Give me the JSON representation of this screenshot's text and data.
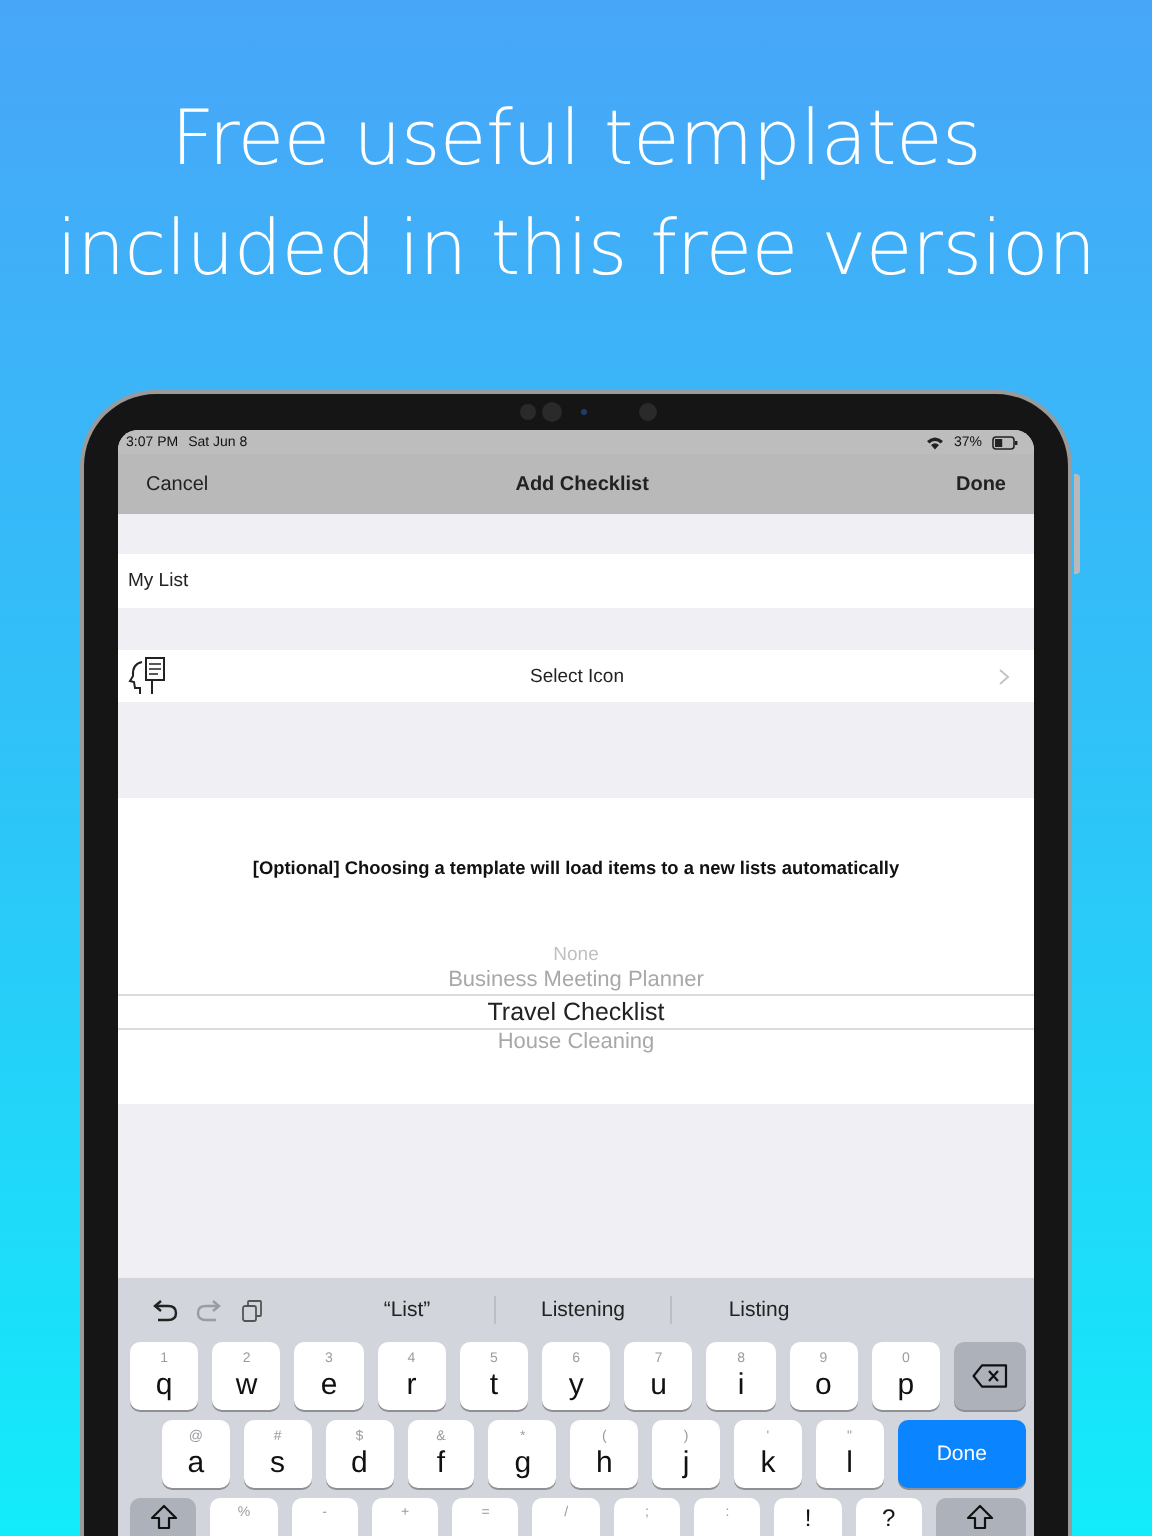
{
  "headline": "Free useful templates included in this free version",
  "status_bar": {
    "time": "3:07 PM",
    "date": "Sat Jun 8",
    "battery": "37%"
  },
  "nav": {
    "left": "Cancel",
    "title": "Add Checklist",
    "right": "Done"
  },
  "name_field": {
    "value": "My List"
  },
  "icon_row": {
    "label": "Select Icon"
  },
  "template_hint": "[Optional] Choosing a template will load items to a new lists automatically",
  "picker": [
    {
      "label": "None",
      "selected": false
    },
    {
      "label": "Business Meeting Planner",
      "selected": false
    },
    {
      "label": "Travel Checklist",
      "selected": true
    },
    {
      "label": "House Cleaning",
      "selected": false
    }
  ],
  "keyboard": {
    "suggestions": [
      "“List”",
      "Listening",
      "Listing"
    ],
    "rows": [
      [
        {
          "kind": "letter",
          "key": "q",
          "hint": "1"
        },
        {
          "kind": "letter",
          "key": "w",
          "hint": "2"
        },
        {
          "kind": "letter",
          "key": "e",
          "hint": "3"
        },
        {
          "kind": "letter",
          "key": "r",
          "hint": "4"
        },
        {
          "kind": "letter",
          "key": "t",
          "hint": "5"
        },
        {
          "kind": "letter",
          "key": "y",
          "hint": "6"
        },
        {
          "kind": "letter",
          "key": "u",
          "hint": "7"
        },
        {
          "kind": "letter",
          "key": "i",
          "hint": "8"
        },
        {
          "kind": "letter",
          "key": "o",
          "hint": "9"
        },
        {
          "kind": "letter",
          "key": "p",
          "hint": "0"
        },
        {
          "kind": "backspace"
        }
      ],
      [
        {
          "kind": "letter",
          "key": "a",
          "hint": "@"
        },
        {
          "kind": "letter",
          "key": "s",
          "hint": "#"
        },
        {
          "kind": "letter",
          "key": "d",
          "hint": "$"
        },
        {
          "kind": "letter",
          "key": "f",
          "hint": "&"
        },
        {
          "kind": "letter",
          "key": "g",
          "hint": "*"
        },
        {
          "kind": "letter",
          "key": "h",
          "hint": "("
        },
        {
          "kind": "letter",
          "key": "j",
          "hint": ")"
        },
        {
          "kind": "letter",
          "key": "k",
          "hint": "'"
        },
        {
          "kind": "letter",
          "key": "l",
          "hint": "\""
        },
        {
          "kind": "return",
          "key": "Done"
        }
      ],
      [
        {
          "kind": "shift"
        },
        {
          "kind": "letter",
          "hint": "%"
        },
        {
          "kind": "letter",
          "hint": "-"
        },
        {
          "kind": "letter",
          "hint": "+"
        },
        {
          "kind": "letter",
          "hint": "="
        },
        {
          "kind": "letter",
          "hint": "/"
        },
        {
          "kind": "letter",
          "hint": ";"
        },
        {
          "kind": "letter",
          "hint": ":"
        },
        {
          "kind": "symbol",
          "key": "!"
        },
        {
          "kind": "symbol",
          "key": "?"
        },
        {
          "kind": "shift"
        }
      ]
    ]
  }
}
